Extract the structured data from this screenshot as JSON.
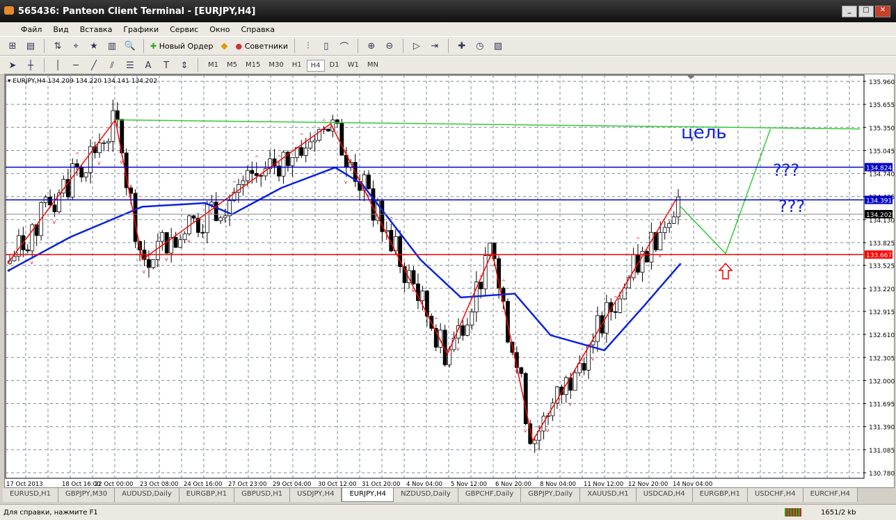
{
  "window": {
    "title": "565436: Panteon Client Terminal - [EURJPY,H4]"
  },
  "menu": [
    "Файл",
    "Вид",
    "Вставка",
    "Графики",
    "Сервис",
    "Окно",
    "Справка"
  ],
  "toolbar": {
    "new_order": "Новый Ордер",
    "advisors": "Советники"
  },
  "timeframes": [
    "M1",
    "M5",
    "M15",
    "M30",
    "H1",
    "H4",
    "D1",
    "W1",
    "MN"
  ],
  "active_timeframe": "H4",
  "chart_header": "EURJPY,H4  134.209 134.220 134.141 134.202",
  "chart_data": {
    "type": "candlestick",
    "symbol": "EURJPY",
    "timeframe": "H4",
    "ylim": [
      130.78,
      135.96
    ],
    "y_ticks": [
      "135.960",
      "135.655",
      "135.350",
      "135.045",
      "134.740",
      "134.435",
      "134.130",
      "133.825",
      "133.525",
      "133.220",
      "132.915",
      "132.610",
      "132.305",
      "132.000",
      "131.695",
      "131.390",
      "131.085",
      "130.780"
    ],
    "x_ticks": [
      "17 Oct 2013",
      "18 Oct 16:00",
      "22 Oct 00:00",
      "23 Oct 08:00",
      "24 Oct 16:00",
      "27 Oct 23:00",
      "29 Oct 04:00",
      "30 Oct 12:00",
      "31 Oct 20:00",
      "4 Nov 04:00",
      "5 Nov 12:00",
      "6 Nov 20:00",
      "8 Nov 04:00",
      "11 Nov 12:00",
      "12 Nov 20:00",
      "14 Nov 04:00"
    ],
    "bars": 150,
    "zigzag": [
      [
        0,
        133.55
      ],
      [
        24,
        135.45
      ],
      [
        30,
        133.6
      ],
      [
        72,
        135.4
      ],
      [
        98,
        132.35
      ],
      [
        108,
        133.7
      ],
      [
        117,
        131.2
      ],
      [
        149,
        134.4
      ]
    ],
    "moving_average": [
      [
        0,
        133.45
      ],
      [
        14,
        133.9
      ],
      [
        30,
        134.3
      ],
      [
        44,
        134.35
      ],
      [
        50,
        134.2
      ],
      [
        61,
        134.55
      ],
      [
        73,
        134.82
      ],
      [
        79,
        134.6
      ],
      [
        92,
        133.6
      ],
      [
        101,
        133.1
      ],
      [
        113,
        133.15
      ],
      [
        121,
        132.6
      ],
      [
        133,
        132.4
      ],
      [
        142,
        133.0
      ],
      [
        150,
        133.55
      ]
    ],
    "levels": [
      {
        "price": "134.824",
        "color": "#0000cc"
      },
      {
        "price": "134.391",
        "color": "#0000cc"
      },
      {
        "price": "133.667",
        "color": "#ff0000"
      }
    ],
    "last_price": "134.202",
    "target_line": [
      [
        24,
        135.45
      ],
      [
        190,
        135.33
      ]
    ],
    "forecast": [
      [
        150,
        134.3
      ],
      [
        160,
        133.68
      ],
      [
        170,
        135.33
      ]
    ],
    "annotations": {
      "target": "цель",
      "q1": "???",
      "q2": "???"
    }
  },
  "tabs": [
    "EURUSD,H1",
    "GBPJPY,M30",
    "AUDUSD,Daily",
    "EURGBP,H1",
    "GBPUSD,H1",
    "USDJPY,H4",
    "EURJPY,H4",
    "NZDUSD,Daily",
    "GBPCHF,Daily",
    "GBPJPY,Daily",
    "XAUUSD,H1",
    "USDCAD,H4",
    "EURGBP,H1",
    "USDCHF,H4",
    "EURCHF,H4"
  ],
  "active_tab": "EURJPY,H4",
  "status": {
    "help": "Для справки, нажмите F1",
    "traffic": "1651/2 kb"
  }
}
